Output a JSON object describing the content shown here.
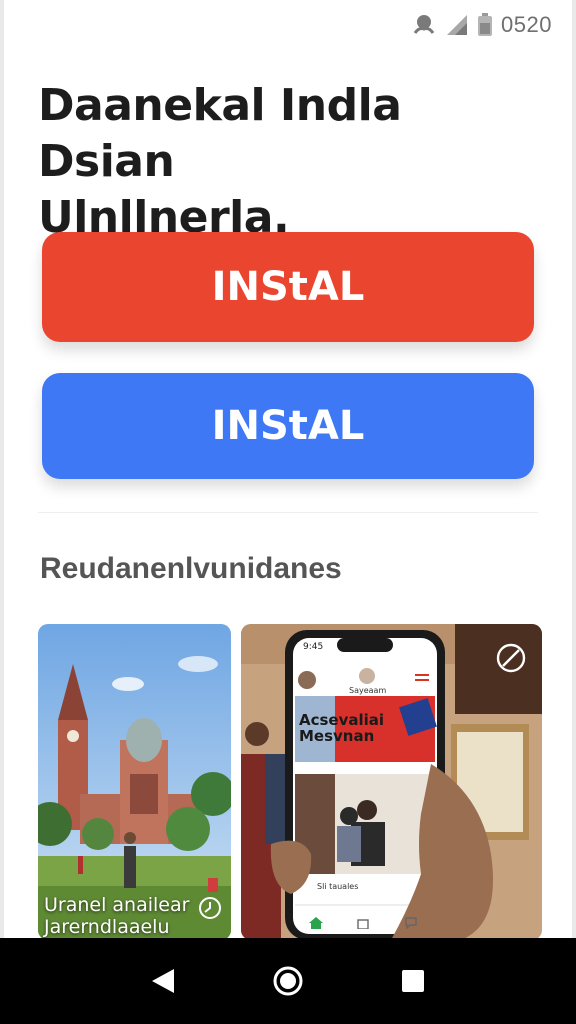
{
  "status_bar": {
    "time": "0520",
    "icons": [
      "notification-icon",
      "signal-icon",
      "battery-icon"
    ]
  },
  "headline": {
    "line1": "Daanekal Indla Dsian",
    "line2": "Ulnllnerla."
  },
  "buttons": {
    "primary_label": "INStAL",
    "secondary_label": "INStAL",
    "primary_color": "#e9452f",
    "secondary_color": "#3f78f5"
  },
  "section": {
    "title": "Reudanenlvunidanes"
  },
  "cards": [
    {
      "caption_line1": "Uranel anailear",
      "caption_line2": "Jarerndlaaelu",
      "badge_icon": "clock-icon"
    },
    {
      "badge_icon": "block-icon",
      "phone": {
        "time": "9:45",
        "header_name": "Sayeaam",
        "banner_line1": "Acsevaliai",
        "banner_line2": "Mesvnan",
        "post_title": "Sli tauales",
        "tab_icons": [
          "home-icon",
          "bag-icon",
          "chat-icon"
        ]
      }
    }
  ],
  "nav": {
    "buttons": [
      "back-icon",
      "home-circle-icon",
      "recents-icon"
    ]
  }
}
